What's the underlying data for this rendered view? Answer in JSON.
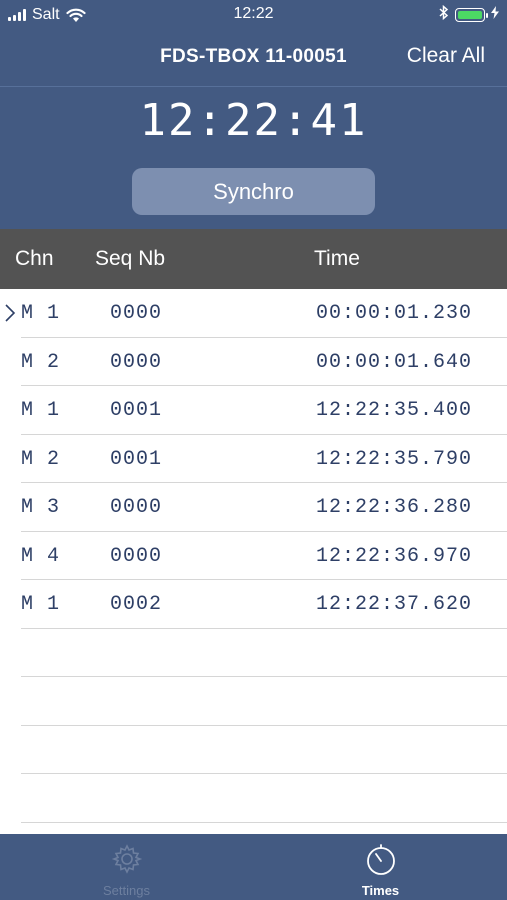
{
  "status_bar": {
    "carrier": "Salt",
    "time": "12:22",
    "battery_color": "#4cd964"
  },
  "nav": {
    "title": "FDS-TBOX 11-00051",
    "clear_label": "Clear All"
  },
  "clock": {
    "time": "12:22:41"
  },
  "synchro_label": "Synchro",
  "table": {
    "headers": [
      "Chn",
      "Seq Nb",
      "Time"
    ],
    "rows": [
      {
        "chn": "M 1",
        "seq": "0000",
        "time": "00:00:01.230"
      },
      {
        "chn": "M 2",
        "seq": "0000",
        "time": "00:00:01.640"
      },
      {
        "chn": "M 1",
        "seq": "0001",
        "time": "12:22:35.400"
      },
      {
        "chn": "M 2",
        "seq": "0001",
        "time": "12:22:35.790"
      },
      {
        "chn": "M 3",
        "seq": "0000",
        "time": "12:22:36.280"
      },
      {
        "chn": "M 4",
        "seq": "0000",
        "time": "12:22:36.970"
      },
      {
        "chn": "M 1",
        "seq": "0002",
        "time": "12:22:37.620"
      }
    ]
  },
  "tabs": [
    {
      "label": "Settings",
      "icon": "gear-icon",
      "active": false
    },
    {
      "label": "Times",
      "icon": "stopwatch-icon",
      "active": true
    }
  ],
  "colors": {
    "primary": "#435a82",
    "header_row": "#535353",
    "button": "#7d8fb0",
    "table_text": "#2e3f66"
  }
}
